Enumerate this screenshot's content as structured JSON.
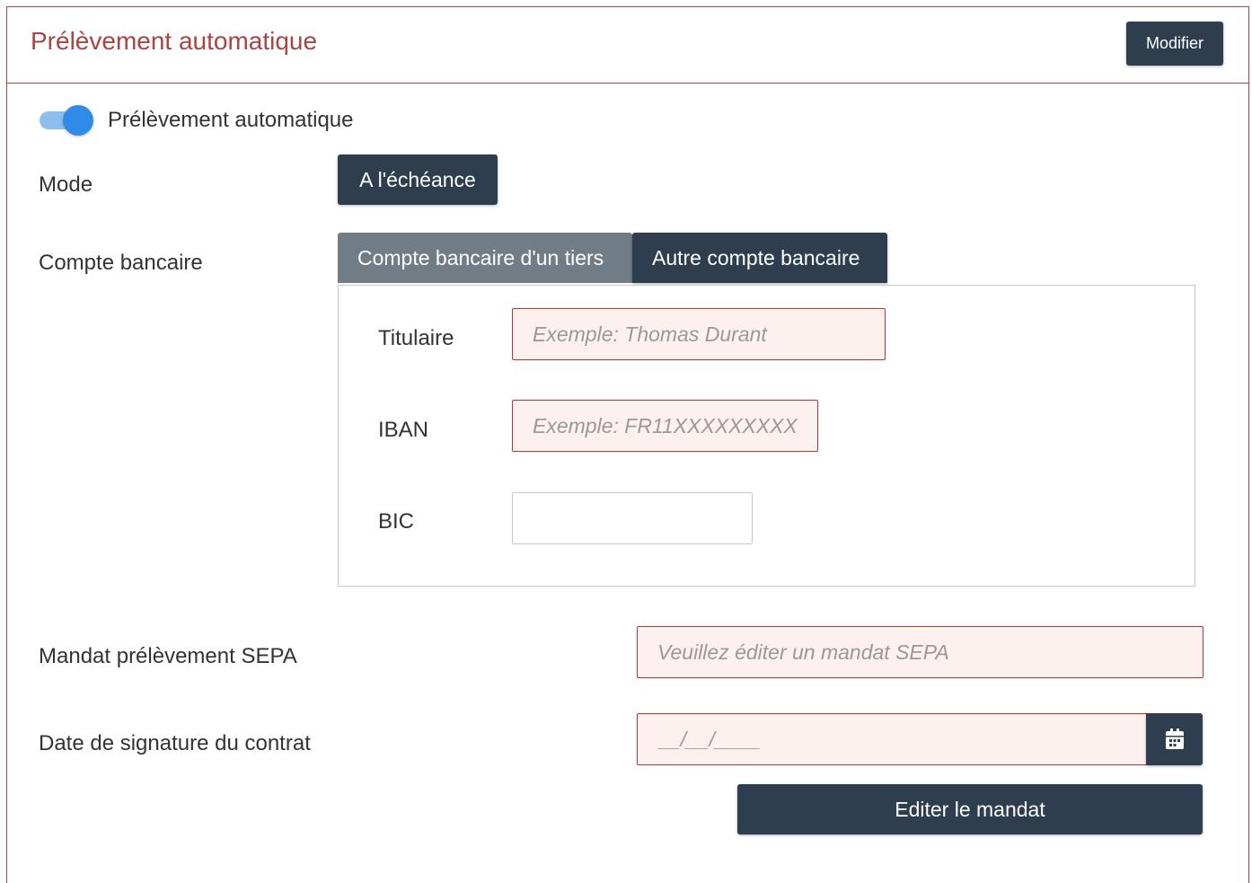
{
  "header": {
    "title": "Prélèvement automatique",
    "modify_label": "Modifier"
  },
  "toggle": {
    "label": "Prélèvement automatique",
    "enabled": true,
    "color": "#2f8ae8"
  },
  "mode": {
    "label": "Mode",
    "value": "A l'échéance"
  },
  "bank_account": {
    "label": "Compte bancaire",
    "tabs": [
      {
        "label": "Compte bancaire d'un tiers",
        "active": false
      },
      {
        "label": "Autre compte bancaire",
        "active": true
      }
    ],
    "fields": {
      "holder_label": "Titulaire",
      "holder_placeholder": "Exemple: Thomas Durant",
      "iban_label": "IBAN",
      "iban_placeholder": "Exemple: FR11XXXXXXXXX",
      "bic_label": "BIC",
      "bic_value": ""
    }
  },
  "sepa": {
    "label": "Mandat prélèvement SEPA",
    "placeholder": "Veuillez éditer un mandat SEPA"
  },
  "contract_date": {
    "label": "Date de signature du contrat",
    "placeholder": "__/__/____",
    "calendar_icon": "calendar-icon"
  },
  "actions": {
    "edit_mandate_label": "Editer le mandat"
  },
  "colors": {
    "accent_dark": "#2e3e4e",
    "error_border": "#c9302c",
    "error_bg": "#fdf1f0",
    "title": "#a94442"
  }
}
